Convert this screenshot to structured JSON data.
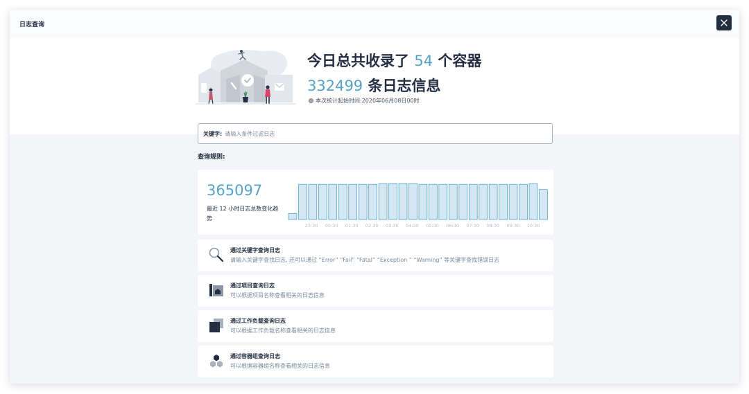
{
  "modal": {
    "title": "日志查询",
    "close_icon": "close-icon"
  },
  "hero": {
    "line1_prefix": "今日总共收录了",
    "container_count": "54",
    "line1_suffix": "个容器",
    "log_count": "332499",
    "line2_suffix": "条日志信息",
    "note": "本次统计起始时间:2020年06月08日00时",
    "illustration_icon": "buildings-illustration"
  },
  "search": {
    "label": "关键字:",
    "placeholder": "请输入条件过滤日志",
    "value": ""
  },
  "rules_title": "查询规则:",
  "stats": {
    "total": "365097",
    "description": "最近 12 小时日志总数变化趋势"
  },
  "chart_data": {
    "type": "bar",
    "x_ticks": [
      "23:30",
      "00:30",
      "01:30",
      "02:30",
      "03:30",
      "04:30",
      "05:30",
      "06:30",
      "07:30",
      "08:30",
      "09:30",
      "10:30"
    ],
    "values": [
      7,
      41,
      41,
      41,
      41,
      41,
      41,
      41,
      41,
      42,
      42,
      42,
      42,
      41,
      41,
      41,
      41,
      41,
      41,
      41,
      41,
      41,
      41,
      41,
      42,
      35
    ],
    "ylim": [
      0,
      42
    ],
    "grid": false,
    "colors": {
      "fill": "#d4e8f3",
      "stroke": "#55a3c9"
    }
  },
  "rules": [
    {
      "title": "通过关键字查询日志",
      "desc": "请输入关键字查找日志, 还可以通过 “Error” “Fail” “Fatal” “Exception ” “Warning” 等关键字查找错误日志",
      "icon": "magnifier-icon"
    },
    {
      "title": "通过项目查询日志",
      "desc": "可以根据项目名称查看相关的日志信息",
      "icon": "project-icon"
    },
    {
      "title": "通过工作负载查询日志",
      "desc": "可以根据工作负载名称查看相关的日志信息",
      "icon": "workload-icon"
    },
    {
      "title": "通过容器组查询日志",
      "desc": "可以根据容器组名称查看相关的日志信息",
      "icon": "pod-group-icon"
    }
  ],
  "colors": {
    "accent": "#55a3c9",
    "text": "#242e42",
    "muted": "#79879c",
    "background": "#f3f5f8"
  }
}
